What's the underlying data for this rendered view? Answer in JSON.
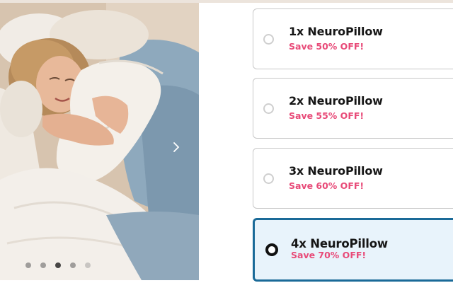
{
  "gallery": {
    "image_alt": "",
    "next_icon": "chevron-right-icon",
    "dot_count": 5,
    "active_dot": 2
  },
  "bundle_options": [
    {
      "title": "1x NeuroPillow",
      "savings": "Save 50% OFF!",
      "selected": false
    },
    {
      "title": "2x NeuroPillow",
      "savings": "Save 55% OFF!",
      "selected": false
    },
    {
      "title": "3x NeuroPillow",
      "savings": "Save 60% OFF!",
      "selected": false
    },
    {
      "title": "4x NeuroPillow",
      "savings": "Save 70% OFF!",
      "selected": true
    }
  ],
  "colors": {
    "savings_text": "#e84a78",
    "selected_border": "#1a6a98",
    "selected_background": "#e8f3fb"
  }
}
